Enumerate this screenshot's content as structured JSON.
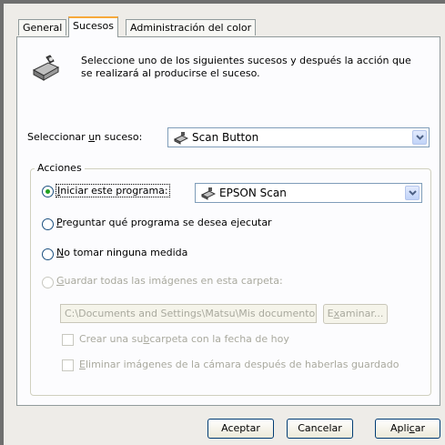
{
  "tabs": [
    "General",
    "Sucesos",
    "Administración del color"
  ],
  "header": {
    "icon": "scanner-icon",
    "line1": "Seleccione uno de los siguientes sucesos y después la acción que",
    "line2": "se realizará al producirse el suceso."
  },
  "event": {
    "label_pre": "Seleccionar ",
    "label_accel": "u",
    "label_post": "n suceso:",
    "value": "Scan Button"
  },
  "actions": {
    "legend": "Acciones",
    "start_program": {
      "accel": "I",
      "rest": "niciar este programa:",
      "selected": true
    },
    "program_value": "EPSON Scan",
    "ask": {
      "accel": "P",
      "rest": "reguntar qué programa se desea ejecutar"
    },
    "none": {
      "accel": "N",
      "rest": "o tomar ninguna medida"
    },
    "save": {
      "accel": "G",
      "rest": "uardar todas las imágenes en esta carpeta:"
    },
    "folder_path": "C:\\Documents and Settings\\Matsu\\Mis documento",
    "browse": {
      "pre": "E",
      "accel": "x",
      "post": "aminar..."
    },
    "subfolder": {
      "pre": "Crear una su",
      "accel": "b",
      "post": "carpeta con la fecha de hoy"
    },
    "delete": {
      "accel": "E",
      "rest": "liminar imágenes de la cámara después de haberlas guardado"
    }
  },
  "buttons": {
    "ok": "Aceptar",
    "cancel": "Cancelar",
    "apply_pre": "Apli",
    "apply_accel": "c",
    "apply_post": "ar"
  }
}
